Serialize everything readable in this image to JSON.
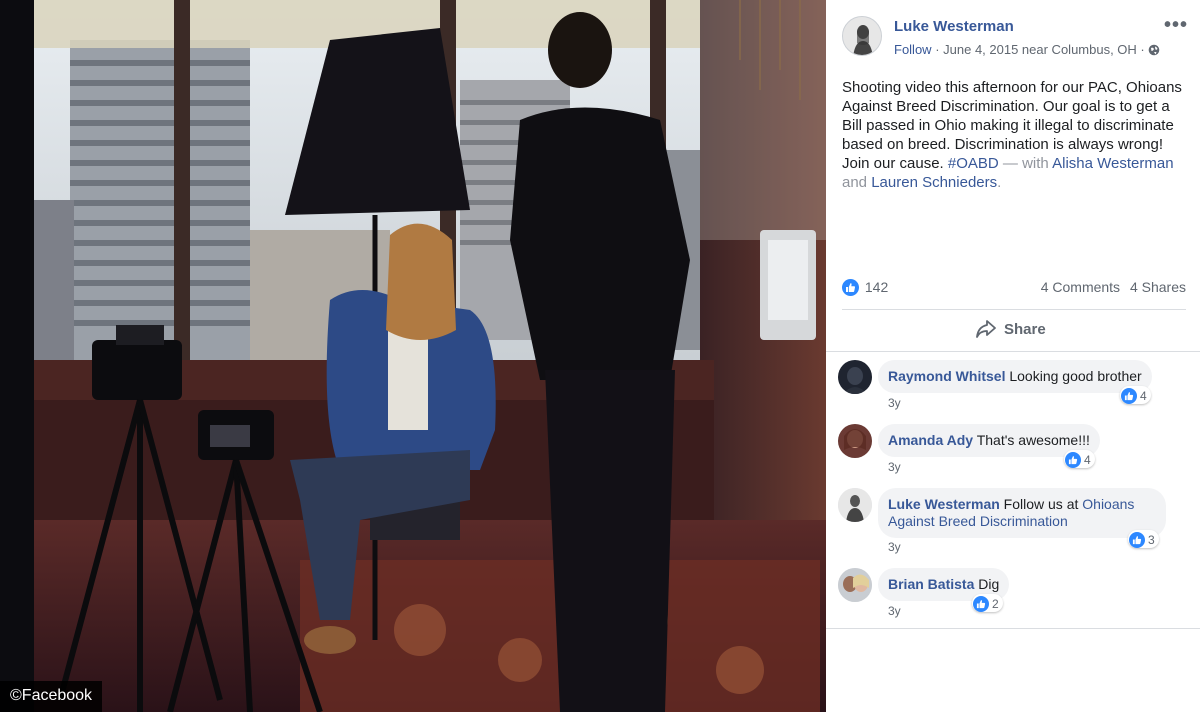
{
  "watermark": "©Facebook",
  "post": {
    "author": "Luke Westerman",
    "follow_label": "Follow",
    "meta_sep": " · ",
    "date_location": "June 4, 2015 near Columbus, OH",
    "meta_sep2": " · ",
    "more_label": "•••",
    "text_main": "Shooting video this afternoon for our PAC, Ohioans Against Breed Discrimination. Our goal is to get a Bill passed in Ohio making it illegal to discriminate based on breed. Discrimination is always wrong! Join our cause. ",
    "hashtag": "#OABD",
    "with_label": " — with ",
    "tagged_1": "Alisha Westerman",
    "and_label": " and ",
    "tagged_2": "Lauren Schnieders",
    "period": "."
  },
  "reactions": {
    "likes": "142",
    "comments": "4 Comments",
    "shares": "4 Shares"
  },
  "actions": {
    "share_label": "Share"
  },
  "comments": [
    {
      "name": "Raymond Whitsel",
      "text": "Looking good brother",
      "likes": "4",
      "time": "3y"
    },
    {
      "name": "Amanda Ady",
      "text": "That's awesome!!!",
      "likes": "4",
      "time": "3y"
    },
    {
      "name": "Luke Westerman",
      "text": "Follow us at ",
      "link": "Ohioans Against Breed Discrimination",
      "likes": "3",
      "time": "3y"
    },
    {
      "name": "Brian Batista",
      "text": "Dig",
      "likes": "2",
      "time": "3y"
    }
  ],
  "colors": {
    "link": "#385898",
    "like_blue": "#2d88ff",
    "bubble": "#f2f3f5"
  }
}
